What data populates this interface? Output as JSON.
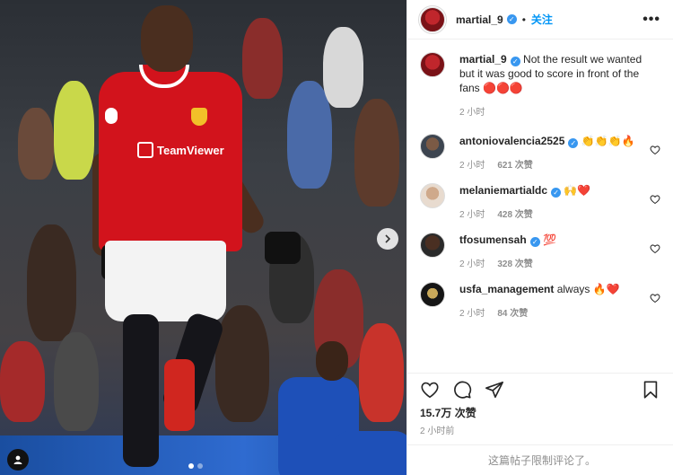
{
  "post": {
    "author": "martial_9",
    "follow_label": "关注",
    "more_label": "•••",
    "caption": {
      "username": "martial_9",
      "text": "Not the result we wanted but it was good to score in front of the fans 🔴🔴🔴",
      "time": "2 小时"
    },
    "comments": [
      {
        "username": "antoniovalencia2525",
        "verified": true,
        "text": "👏👏👏🔥",
        "time": "2 小时",
        "likes": "621 次赞"
      },
      {
        "username": "melaniemartialdc",
        "verified": true,
        "text": "🙌❤️",
        "time": "2 小时",
        "likes": "428 次赞"
      },
      {
        "username": "tfosumensah",
        "verified": true,
        "text": "💯",
        "time": "2 小时",
        "likes": "328 次赞"
      },
      {
        "username": "usfa_management",
        "verified": false,
        "text": "always 🔥❤️",
        "time": "2 小时",
        "likes": "84 次赞"
      }
    ],
    "like_count": "15.7万 次赞",
    "posted_time": "2 小时前",
    "comments_limited": "这篇帖子限制评论了。"
  },
  "photo": {
    "sponsor_text": "TeamViewer"
  },
  "icons": {
    "like": "heart-icon",
    "comment": "comment-icon",
    "share": "paper-plane-icon",
    "save": "bookmark-icon",
    "next": "chevron-right-icon",
    "tag": "person-icon"
  },
  "colors": {
    "accent": "#0095f6",
    "verified": "#3897f0",
    "muted": "#8e8e8e"
  }
}
